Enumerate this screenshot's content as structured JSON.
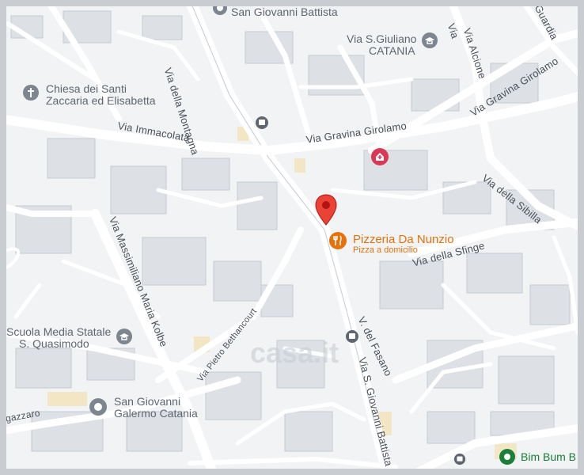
{
  "map": {
    "streets": {
      "via_della_montagna": "Via della Montagna",
      "via_immacolata": "Via Immacolata",
      "via_gravina_girolamo_1": "Via Gravina Girolamo",
      "via_gravina_girolamo_2": "Via Gravina Girolamo",
      "via_alcione": "Via Alcione",
      "via_guardia": "Guardia",
      "via_della_sibilla": "Via della Sibilla",
      "via_della_sfinge": "Via della Sfinge",
      "via_massimiliano": "Via Massimiliano Maria Kolbe",
      "via_pietro": "Via Pietro Bethancourt",
      "via_del_fasano": "V. del Fasano",
      "via_s_giovanni": "Via S. Giovanni Battista",
      "zazzaro": "gazzaro",
      "alcione_top": "Via"
    },
    "places": {
      "san_giovanni_battista": "San Giovanni Battista",
      "via_s_giuliano": "Via S.Giuliano",
      "catania": "CATANIA",
      "chiesa_line1": "Chiesa dei Santi",
      "chiesa_line2": "Zaccaria ed Elisabetta",
      "pizzeria_name": "Pizzeria Da Nunzio",
      "pizzeria_sub": "Pizza a domicilio",
      "scuola_line1": "Scuola Media Statale",
      "scuola_line2": "S. Quasimodo",
      "sgiovanni_line1": "San Giovanni",
      "sgiovanni_line2": "Galermo Catania",
      "bim_bum": "Bim Bum B",
      "watermark": "casa.it"
    },
    "colors": {
      "road": "#ffffff",
      "block": "#dfe3e8",
      "background": "#f1f3f4",
      "pin": "#ea4335",
      "poi_orange": "#e8710a",
      "poi_green": "#188038",
      "hospital": "#d93954"
    },
    "icons": [
      "church-icon",
      "school-icon",
      "hospital-icon",
      "restaurant-icon",
      "bus-stop-icon",
      "location-pin-icon",
      "place-icon"
    ]
  }
}
